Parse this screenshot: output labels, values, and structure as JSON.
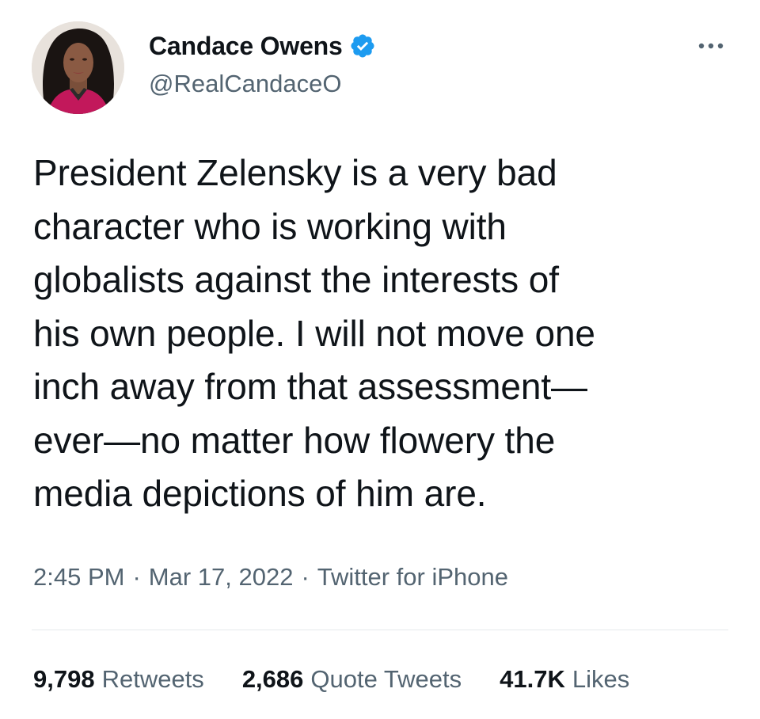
{
  "author": {
    "display_name": "Candace Owens",
    "handle": "@RealCandaceO",
    "verified": true,
    "verified_color": "#1d9bf0"
  },
  "tweet": {
    "text": "President Zelensky is a very bad\ncharacter who is working with\nglobalists against the interests of\nhis own people. I will not move one\ninch away from that assessment—\never—no matter how flowery the\nmedia depictions of him are.",
    "time": "2:45 PM",
    "date": "Mar 17, 2022",
    "source": "Twitter for iPhone",
    "separator": "·"
  },
  "stats": {
    "retweets_count": "9,798",
    "retweets_label": "Retweets",
    "quotes_count": "2,686",
    "quotes_label": "Quote Tweets",
    "likes_count": "41.7K",
    "likes_label": "Likes"
  },
  "icons": {
    "more": "more-horizontal-icon",
    "verified": "verified-badge-icon"
  },
  "colors": {
    "text_primary": "#0f1419",
    "text_secondary": "#536471",
    "divider": "#e6e9eb"
  }
}
